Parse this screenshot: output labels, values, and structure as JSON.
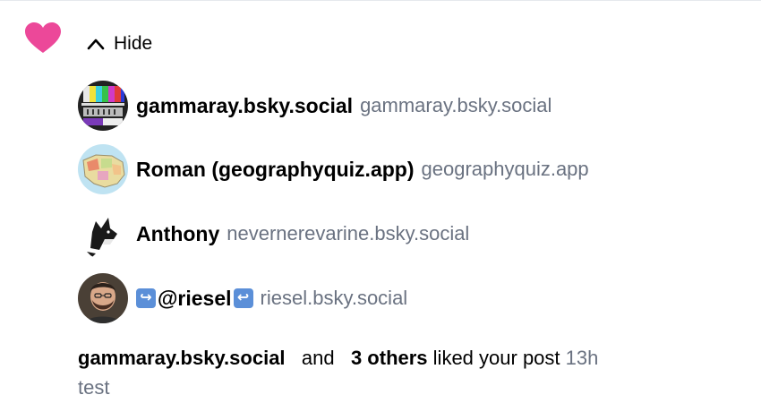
{
  "notification": {
    "toggle_label": "Hide",
    "users": [
      {
        "name": "gammaray.bsky.social",
        "handle": "gammaray.bsky.social"
      },
      {
        "name": "Roman (geographyquiz.app)",
        "handle": "geographyquiz.app"
      },
      {
        "name": "Anthony",
        "handle": "nevernerevarine.bsky.social"
      },
      {
        "name": "@riesel",
        "handle": "riesel.bsky.social"
      }
    ],
    "summary": {
      "first_user": "gammaray.bsky.social",
      "and": "and",
      "others": "3 others",
      "action": "liked your post",
      "time": "13h"
    },
    "post_text": "test"
  },
  "colors": {
    "heart": "#ec4899",
    "muted": "#6a7281"
  },
  "icons": {
    "heart": "heart-icon",
    "chevron": "chevron-up-icon",
    "emoji_left": "arrow-curve-left-emoji",
    "emoji_right": "arrow-curve-right-emoji"
  }
}
